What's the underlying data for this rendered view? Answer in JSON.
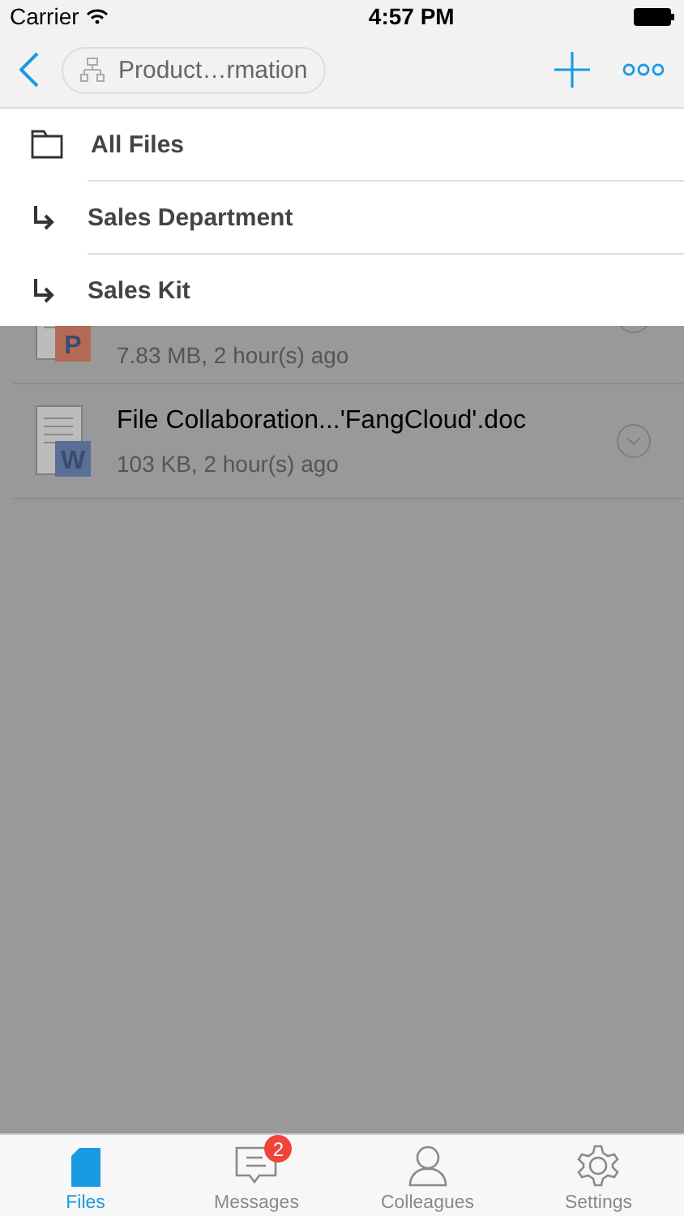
{
  "status_bar": {
    "carrier": "Carrier",
    "time": "4:57 PM"
  },
  "nav": {
    "breadcrumb": "Product…rmation"
  },
  "dropdown": [
    {
      "kind": "folder",
      "label": "All Files"
    },
    {
      "kind": "sub",
      "label": "Sales Department"
    },
    {
      "kind": "sub",
      "label": "Sales Kit"
    }
  ],
  "files": [
    {
      "kind": "ppt",
      "letter": "P",
      "meta": "7.83 MB, 2 hour(s) ago"
    },
    {
      "kind": "doc",
      "letter": "W",
      "name": "File Collaboration...'FangCloud'.doc",
      "meta": "103 KB, 2 hour(s) ago"
    }
  ],
  "tabs": [
    {
      "kind": "files",
      "label": "Files",
      "selected": true
    },
    {
      "kind": "messages",
      "label": "Messages",
      "selected": false,
      "badge": "2"
    },
    {
      "kind": "colleagues",
      "label": "Colleagues",
      "selected": false
    },
    {
      "kind": "settings",
      "label": "Settings",
      "selected": false
    }
  ]
}
